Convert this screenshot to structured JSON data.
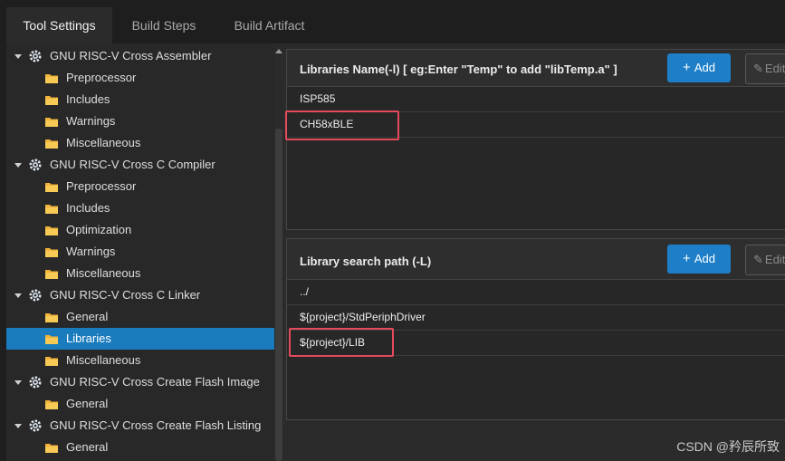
{
  "tabs": [
    {
      "label": "Tool Settings"
    },
    {
      "label": "Build Steps"
    },
    {
      "label": "Build Artifact"
    }
  ],
  "tree": {
    "items": [
      {
        "label": "GNU RISC-V Cross Assembler",
        "icon": "gear-icon"
      },
      {
        "label": "Preprocessor",
        "icon": "folder-icon"
      },
      {
        "label": "Includes",
        "icon": "folder-icon"
      },
      {
        "label": "Warnings",
        "icon": "folder-icon"
      },
      {
        "label": "Miscellaneous",
        "icon": "folder-icon"
      },
      {
        "label": "GNU RISC-V Cross C Compiler",
        "icon": "gear-icon"
      },
      {
        "label": "Preprocessor",
        "icon": "folder-icon"
      },
      {
        "label": "Includes",
        "icon": "folder-icon"
      },
      {
        "label": "Optimization",
        "icon": "folder-icon"
      },
      {
        "label": "Warnings",
        "icon": "folder-icon"
      },
      {
        "label": "Miscellaneous",
        "icon": "folder-icon"
      },
      {
        "label": "GNU RISC-V Cross C Linker",
        "icon": "gear-icon"
      },
      {
        "label": "General",
        "icon": "folder-icon"
      },
      {
        "label": "Libraries",
        "icon": "folder-icon",
        "selected": true
      },
      {
        "label": "Miscellaneous",
        "icon": "folder-icon"
      },
      {
        "label": "GNU RISC-V Cross Create Flash Image",
        "icon": "gear-icon"
      },
      {
        "label": "General",
        "icon": "folder-icon"
      },
      {
        "label": "GNU RISC-V Cross Create Flash Listing",
        "icon": "gear-icon"
      },
      {
        "label": "General",
        "icon": "folder-icon"
      }
    ]
  },
  "libraries_section": {
    "title": "Libraries Name(-l) [ eg:Enter \"Temp\" to add \"libTemp.a\" ]",
    "add_label": "Add",
    "edit_label": "Edit",
    "items": [
      "ISP585",
      "CH58xBLE"
    ]
  },
  "search_path_section": {
    "title": "Library search path (-L)",
    "add_label": "Add",
    "edit_label": "Edit",
    "items": [
      "../",
      "${project}/StdPeriphDriver",
      "${project}/LIB"
    ]
  },
  "watermark": "CSDN @矜辰所致",
  "colors": {
    "accent": "#1e7fc8",
    "selected": "#1a7bbd",
    "highlight": "#e34a5b"
  }
}
